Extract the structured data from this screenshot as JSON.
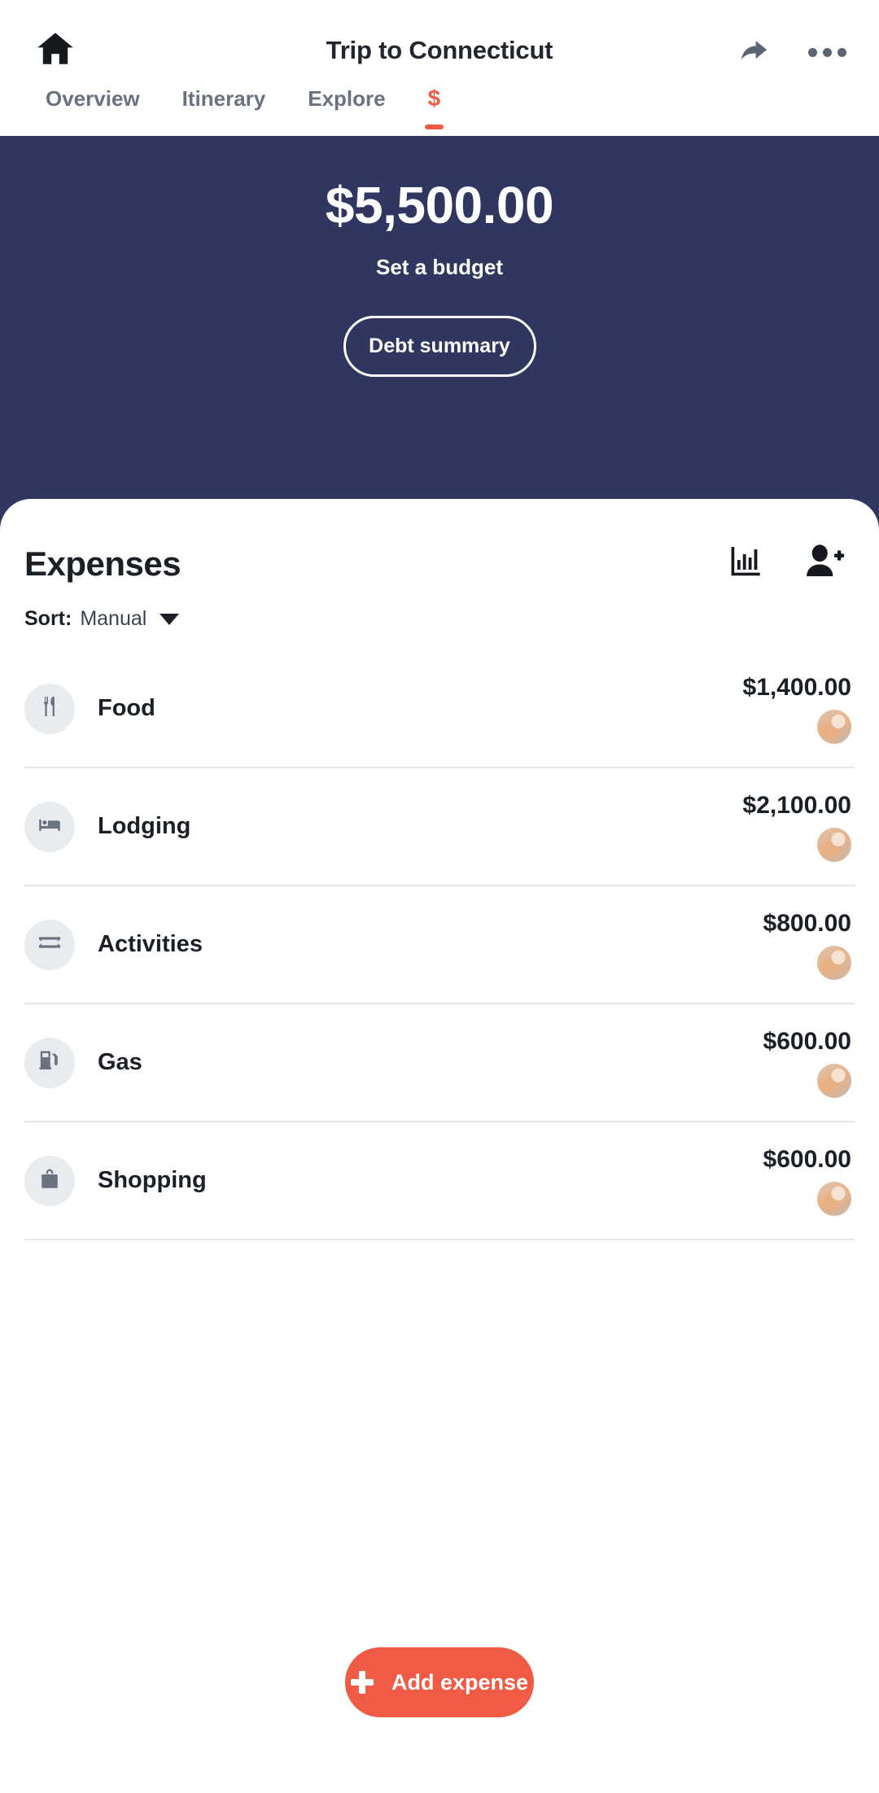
{
  "header": {
    "title": "Trip to Connecticut",
    "home_icon": "home-icon",
    "share_icon": "share-icon",
    "more_icon": "more-options-icon"
  },
  "tabs": [
    {
      "label": "Overview",
      "active": false
    },
    {
      "label": "Itinerary",
      "active": false
    },
    {
      "label": "Explore",
      "active": false
    },
    {
      "label": "$",
      "active": true
    }
  ],
  "budget": {
    "amount": "$5,500.00",
    "set_budget_label": "Set a budget",
    "debt_summary_label": "Debt summary",
    "background_color": "#2f3760"
  },
  "expenses_card": {
    "title": "Expenses",
    "chart_icon": "bar-chart-icon",
    "add_person_icon": "add-person-icon",
    "sort_label": "Sort:",
    "sort_value": "Manual",
    "caret_icon": "chevron-down-icon",
    "items": [
      {
        "name": "Food",
        "amount": "$1,400.00",
        "icon": "cutlery-icon",
        "avatar": "cat-avatar"
      },
      {
        "name": "Lodging",
        "amount": "$2,100.00",
        "icon": "bed-icon",
        "avatar": "cat-avatar"
      },
      {
        "name": "Activities",
        "amount": "$800.00",
        "icon": "ticket-icon",
        "avatar": "cat-avatar"
      },
      {
        "name": "Gas",
        "amount": "$600.00",
        "icon": "fuel-pump-icon",
        "avatar": "cat-avatar"
      },
      {
        "name": "Shopping",
        "amount": "$600.00",
        "icon": "shopping-bag-icon",
        "avatar": "cat-avatar"
      }
    ]
  },
  "footer": {
    "add_expense_label": "Add expense",
    "plus_icon": "plus-icon",
    "accent_color": "#ef5b45"
  }
}
